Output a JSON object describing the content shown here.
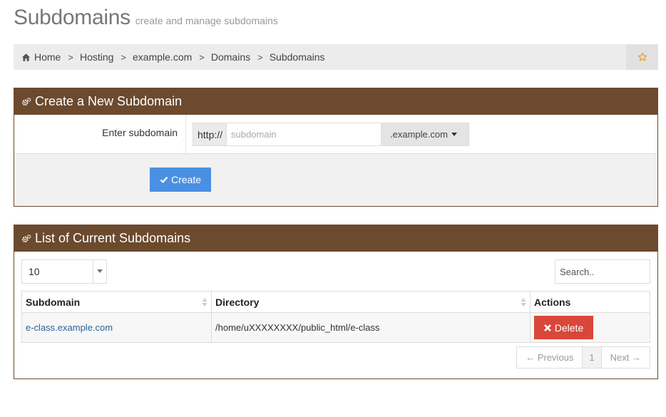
{
  "header": {
    "title": "Subdomains",
    "subtitle": "create and manage subdomains"
  },
  "breadcrumb": {
    "items": [
      "Home",
      "Hosting",
      "example.com",
      "Domains",
      "Subdomains"
    ],
    "separator": ">"
  },
  "create_panel": {
    "title": "Create a New Subdomain",
    "field_label": "Enter subdomain",
    "prefix": "http://",
    "placeholder": "subdomain",
    "value": "",
    "domain_suffix": ".example.com",
    "create_button": "Create"
  },
  "list_panel": {
    "title": "List of Current Subdomains",
    "page_length": "10",
    "search_placeholder": "Search..",
    "columns": [
      "Subdomain",
      "Directory",
      "Actions"
    ],
    "rows": [
      {
        "subdomain": "e-class.example.com",
        "directory": "/home/uXXXXXXXX/public_html/e-class",
        "action": "Delete"
      }
    ],
    "pagination": {
      "previous": "← Previous",
      "current_page": "1",
      "next": "Next →"
    }
  },
  "colors": {
    "panel_header": "#6b4a2e",
    "primary_button": "#4a90e2",
    "danger_button": "#d9473b",
    "link": "#2a6496",
    "star": "#f0a030"
  },
  "icons": {
    "breadcrumb_home": "home-icon",
    "favorite": "star-icon",
    "panel_header": "gears-icon",
    "create": "check-icon",
    "delete": "times-icon",
    "sort": "sort-icon",
    "select_arrow": "caret-down-icon"
  }
}
